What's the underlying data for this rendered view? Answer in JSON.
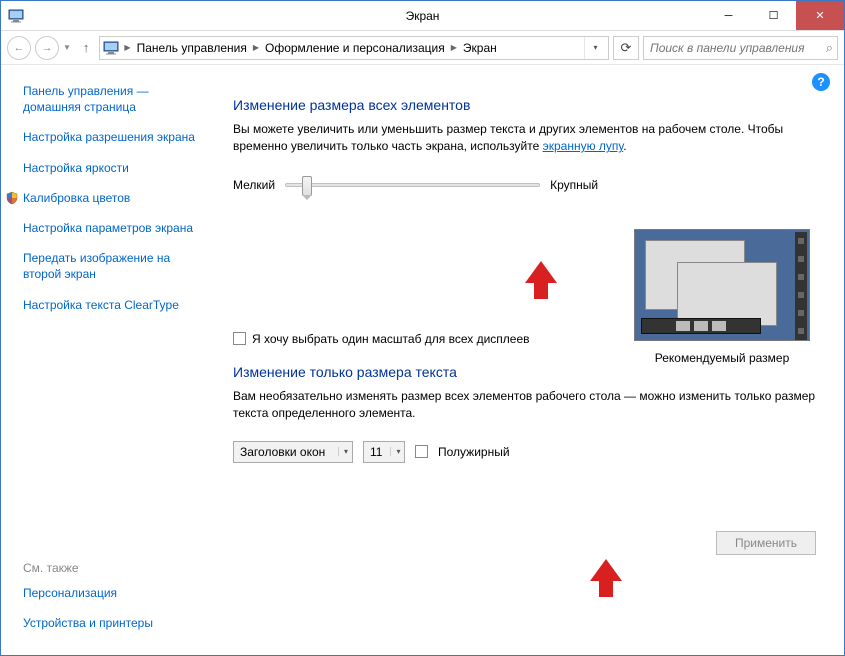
{
  "window": {
    "title": "Экран"
  },
  "breadcrumb": {
    "root": "Панель управления",
    "mid": "Оформление и персонализация",
    "leaf": "Экран"
  },
  "search": {
    "placeholder": "Поиск в панели управления"
  },
  "sidebar": {
    "home1": "Панель управления —",
    "home2": "домашняя страница",
    "items": [
      "Настройка разрешения экрана",
      "Настройка яркости",
      "Калибровка цветов",
      "Настройка параметров экрана",
      "Передать изображение на второй экран",
      "Настройка текста ClearType"
    ],
    "see_also_hdr": "См. также",
    "see_also": [
      "Персонализация",
      "Устройства и принтеры"
    ]
  },
  "main": {
    "title1": "Изменение размера всех элементов",
    "desc1a": "Вы можете увеличить или уменьшить размер текста и других элементов на рабочем столе. Чтобы временно увеличить только часть экрана, используйте ",
    "desc1b": "экранную лупу",
    "desc1c": ".",
    "slider_min": "Мелкий",
    "slider_max": "Крупный",
    "preview_caption": "Рекомендуемый размер",
    "cb1_label": "Я хочу выбрать один масштаб для всех дисплеев",
    "title2": "Изменение только размера текста",
    "desc2": "Вам необязательно изменять размер всех элементов рабочего стола — можно изменить только размер текста определенного элемента.",
    "element_select": "Заголовки окон",
    "size_select": "11",
    "cb2_label": "Полужирный",
    "apply": "Применить"
  }
}
